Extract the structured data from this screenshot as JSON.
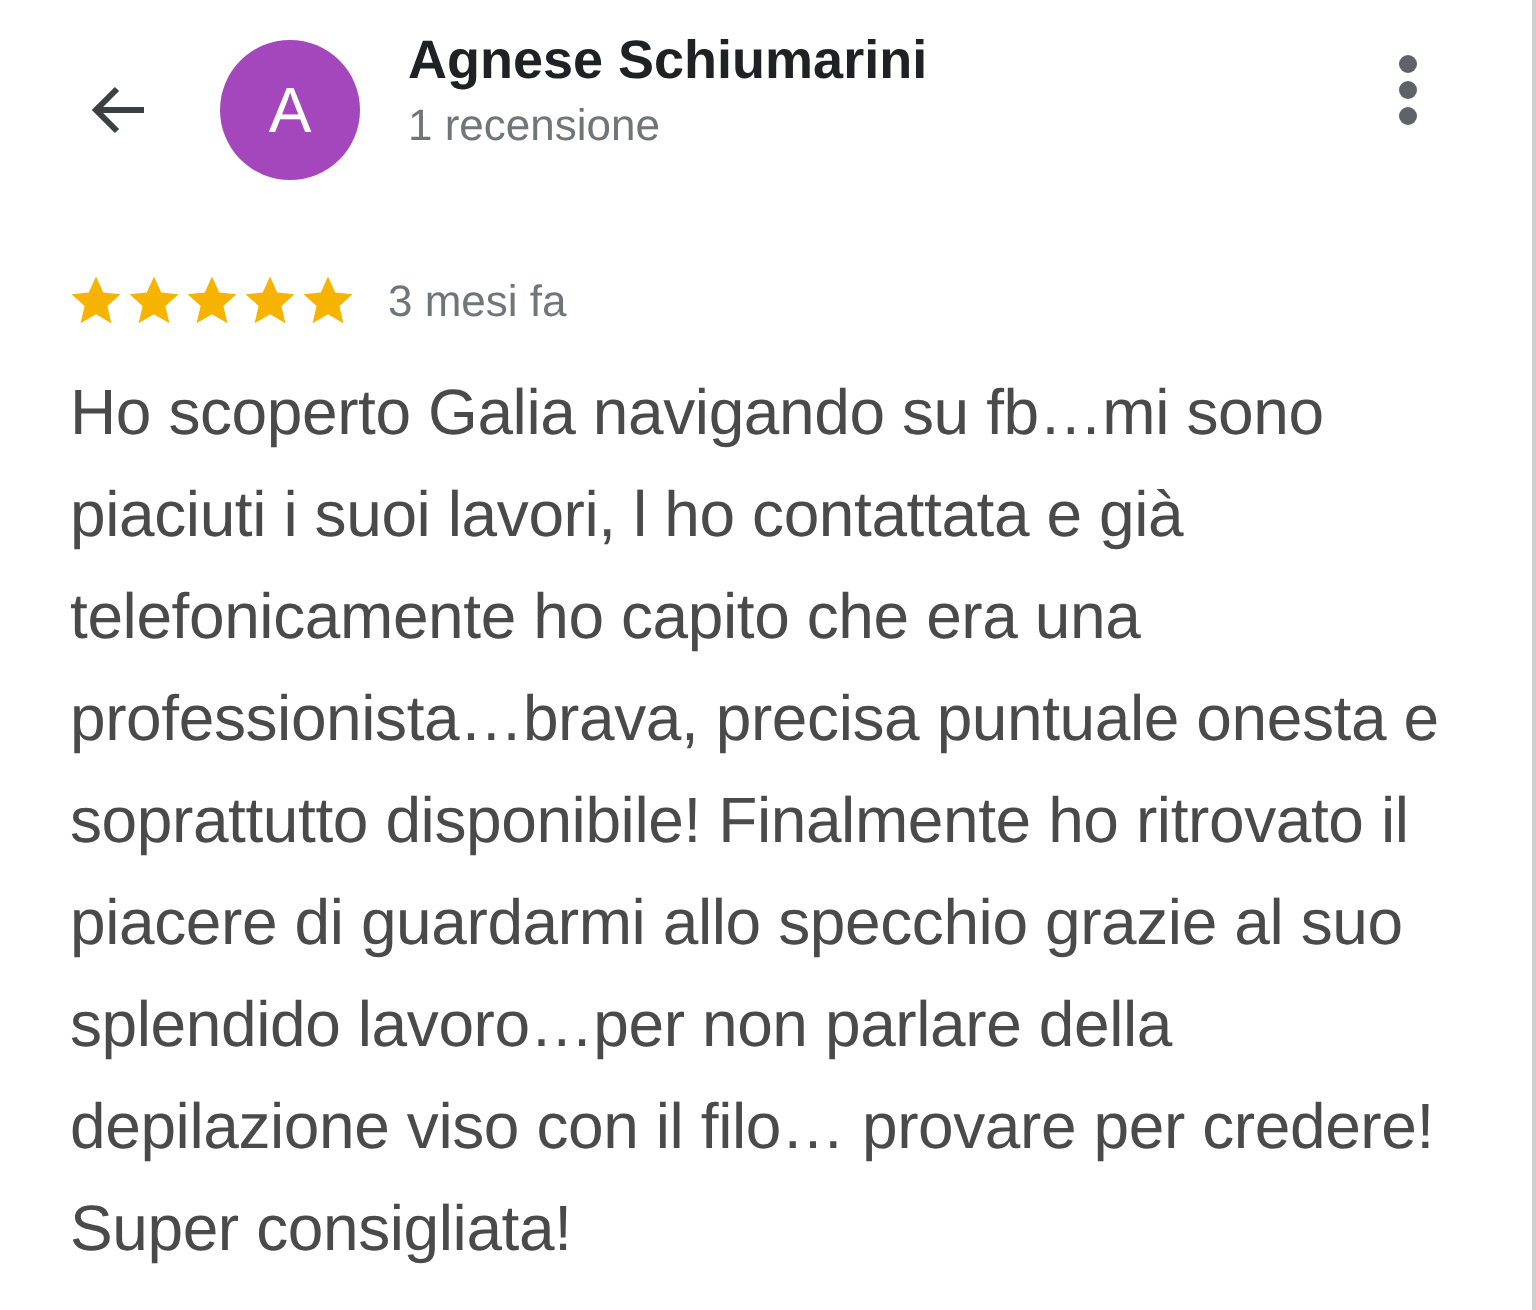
{
  "header": {
    "avatar_letter": "A",
    "name": "Agnese Schiumarini",
    "subtitle": "1 recensione"
  },
  "review": {
    "stars": 5,
    "time": "3 mesi fa",
    "text": "Ho scoperto Galia navigando su fb…mi sono piaciuti i suoi lavori, l ho contattata e già telefonicamente ho capito che era una professionista…brava, precisa puntuale onesta e soprattutto disponibile! Finalmente ho ritrovato il piacere di guardarmi allo specchio grazie al suo splendido lavoro…per non parlare della depilazione viso con il filo… provare per credere! Super consigliata!"
  }
}
